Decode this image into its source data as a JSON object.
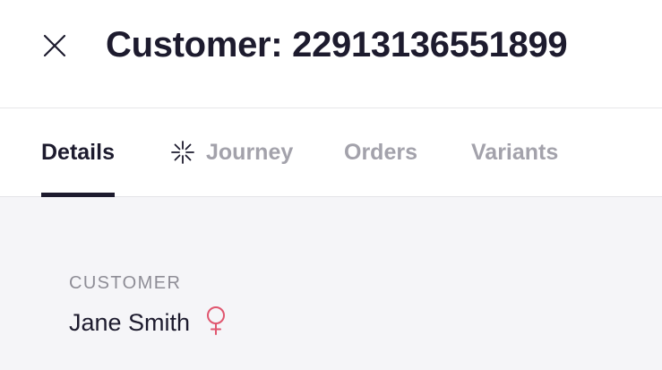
{
  "header": {
    "close_icon": "close-icon",
    "title": "Customer: 22913136551899"
  },
  "tabs": [
    {
      "label": "Details",
      "active": true
    },
    {
      "label": "Journey",
      "active": false,
      "icon": "sparkle-icon"
    },
    {
      "label": "Orders",
      "active": false
    },
    {
      "label": "Variants",
      "active": false
    }
  ],
  "customer": {
    "section_label": "CUSTOMER",
    "name": "Jane Smith",
    "gender_icon": "female-icon"
  },
  "colors": {
    "text_primary": "#1d1b2e",
    "text_muted": "#a3a2ab",
    "female_icon": "#e0566f",
    "content_bg": "#f5f5f8"
  }
}
